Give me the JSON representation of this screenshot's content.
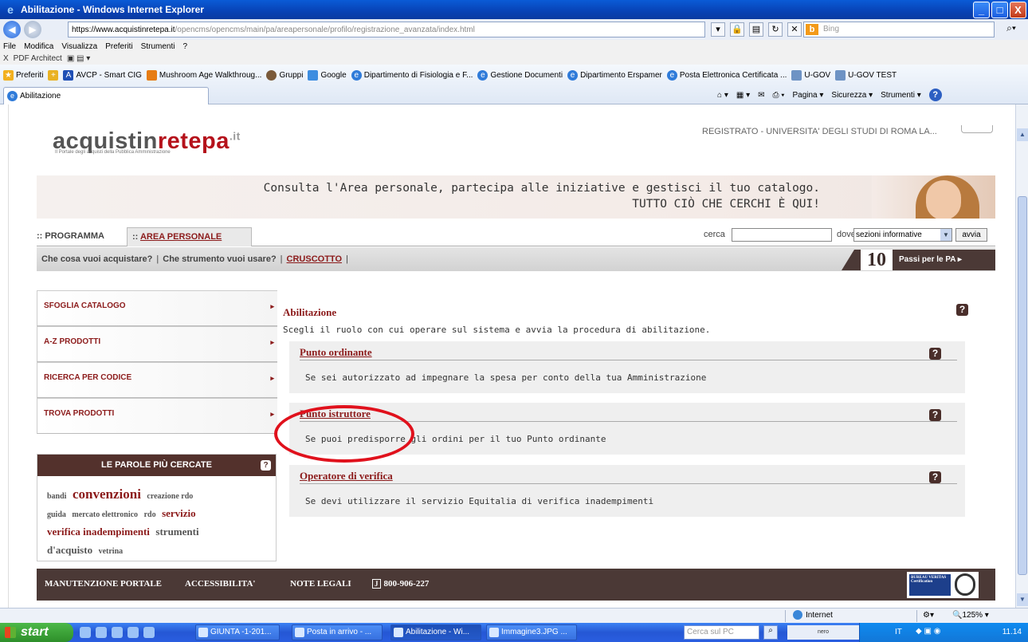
{
  "window": {
    "title": "Abilitazione - Windows Internet Explorer",
    "min": "_",
    "max": "□",
    "close": "X"
  },
  "address": {
    "https": "https://",
    "host": "www.acquistinretepa.it",
    "path": "/opencms/opencms/main/pa/areapersonale/profilo/registrazione_avanzata/index.html",
    "search_placeholder": "Bing"
  },
  "menu": [
    "File",
    "Modifica",
    "Visualizza",
    "Preferiti",
    "Strumenti",
    "?"
  ],
  "pdf_bar": {
    "close": "X",
    "label": "PDF Architect"
  },
  "favorites": {
    "label": "Preferiti",
    "items": [
      "AVCP - Smart CIG",
      "Mushroom Age Walkthroug...",
      "Gruppi",
      "Google",
      "Dipartimento di Fisiologia e F...",
      "Gestione Documenti",
      "Dipartimento Erspamer",
      "Posta Elettronica Certificata ...",
      "U-GOV",
      "U-GOV TEST"
    ]
  },
  "tab": {
    "title": "Abilitazione"
  },
  "commandbar": {
    "page": "Pagina ▾",
    "security": "Sicurezza ▾",
    "tools": "Strumenti ▾",
    "help": "?"
  },
  "site": {
    "logo_a": "acquistin",
    "logo_b": "rete",
    "logo_c": "pa",
    "logo_tld": ".it",
    "logo_sub": "Il Portale degli acquisti della Pubblica Amministrazione",
    "user": "REGISTRATO - UNIVERSITA' DEGLI STUDI DI ROMA LA...",
    "banner_line1": "Consulta l'Area personale, partecipa alle iniziative e gestisci il tuo catalogo.",
    "banner_line2": "TUTTO CIÒ CHE CERCHI È QUI!",
    "tab_programma": ":: PROGRAMMA",
    "tab_area_prefix": "::",
    "tab_area": "AREA PERSONALE",
    "search_label": "cerca",
    "dove_label": "dove",
    "dove_value": "sezioni informative",
    "avvia": "avvia",
    "subnav": {
      "item1": "Che cosa vuoi acquistare?",
      "item2": "Che strumento vuoi usare?",
      "item3": "CRUSCOTTO",
      "sep": "|"
    },
    "passi_num": "10",
    "passi_label": "Passi per le PA ▸",
    "left_menu": [
      "SFOGLIA CATALOGO",
      "A-Z PRODOTTI",
      "RICERCA PER CODICE",
      "TROVA PRODOTTI"
    ],
    "left_menu_arrow": "▸",
    "words_title": "LE PAROLE PIÙ CERCATE",
    "words": {
      "bandi": "bandi",
      "convenzioni": "convenzioni",
      "creazione": "creazione rdo",
      "guida": "guida",
      "mercato": "mercato elettronico",
      "rdo": "rdo",
      "servizio": "servizio",
      "verifica": "verifica inadempimenti",
      "strumenti": "strumenti",
      "dacquisto": "d'acquisto",
      "vetrina": "vetrina"
    },
    "main_title": "Abilitazione",
    "main_intro": "Scegli il ruolo con cui operare sul sistema e avvia la procedura di abilitazione.",
    "help_glyph": "?",
    "roles": [
      {
        "title": "Punto ordinante",
        "desc": "Se sei autorizzato ad impegnare la spesa per conto della tua Amministrazione"
      },
      {
        "title": "Punto istruttore",
        "desc": "Se puoi predisporre gli ordini per il tuo Punto ordinante"
      },
      {
        "title": "Operatore di verifica",
        "desc": "Se devi utilizzare il servizio Equitalia di verifica inadempimenti"
      }
    ],
    "footer": {
      "manutenzione": "MANUTENZIONE PORTALE",
      "accessibilita": "ACCESSIBILITA'",
      "note": "NOTE LEGALI",
      "tel_icon": "J",
      "tel": "800-906-227",
      "cert": "BUREAU VERITAS Certification"
    }
  },
  "statusbar": {
    "zone": "Internet",
    "zoom": "125%"
  },
  "taskbar": {
    "start": "start",
    "buttons": [
      "GIUNTA -1-201...",
      "Posta in arrivo - ...",
      "Abilitazione - Wi...",
      "Immagine3.JPG ..."
    ],
    "desktop_search": "Cerca sul PC",
    "nero": "nero",
    "lang": "IT",
    "clock": "11.14"
  },
  "colors": {
    "brand_red": "#8c1b1b",
    "footer_brown": "#4b3936",
    "annotation_red": "#e0111c"
  }
}
